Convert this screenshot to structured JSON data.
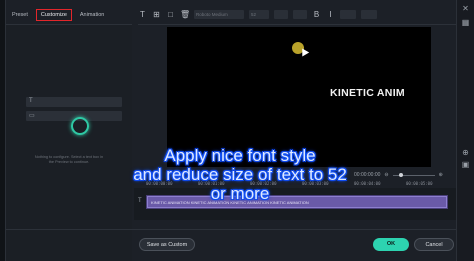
{
  "tabs": [
    {
      "label": "Preset"
    },
    {
      "label": "Customize"
    },
    {
      "label": "Animation"
    }
  ],
  "toolbar": {
    "font_placeholder": "Roboto Medium",
    "size_value": "52",
    "icons": [
      "text-resize-icon",
      "add-text-icon",
      "add-shape-icon",
      "delete-icon"
    ]
  },
  "left_panel": {
    "empty_hint": "Nothing to configure. Select a text box in the Preview to continue."
  },
  "preview": {
    "title_text": "KINETIC ANIM"
  },
  "playback": {
    "timecode": "00:00:00:00"
  },
  "timeline": {
    "ruler": [
      "00:00:00:00",
      "00:00:01:00",
      "00:00:02:00",
      "00:00:03:00",
      "00:00:04:00",
      "00:00:05:00"
    ],
    "clip_text": "KINETIC ANIMATION KINETIC ANIMATION KINETIC ANIMATION KINETIC ANIMATION"
  },
  "caption": {
    "line1": "Apply nice font style",
    "line2": "and reduce size of text to 52",
    "line3": "or more"
  },
  "buttons": {
    "save_as_custom": "Save as Custom",
    "ok": "OK",
    "cancel": "Cancel"
  },
  "colors": {
    "accent_ok": "#2dd3b0",
    "active_tab_outline": "#e2262b",
    "clip": "#6a5aa8"
  }
}
